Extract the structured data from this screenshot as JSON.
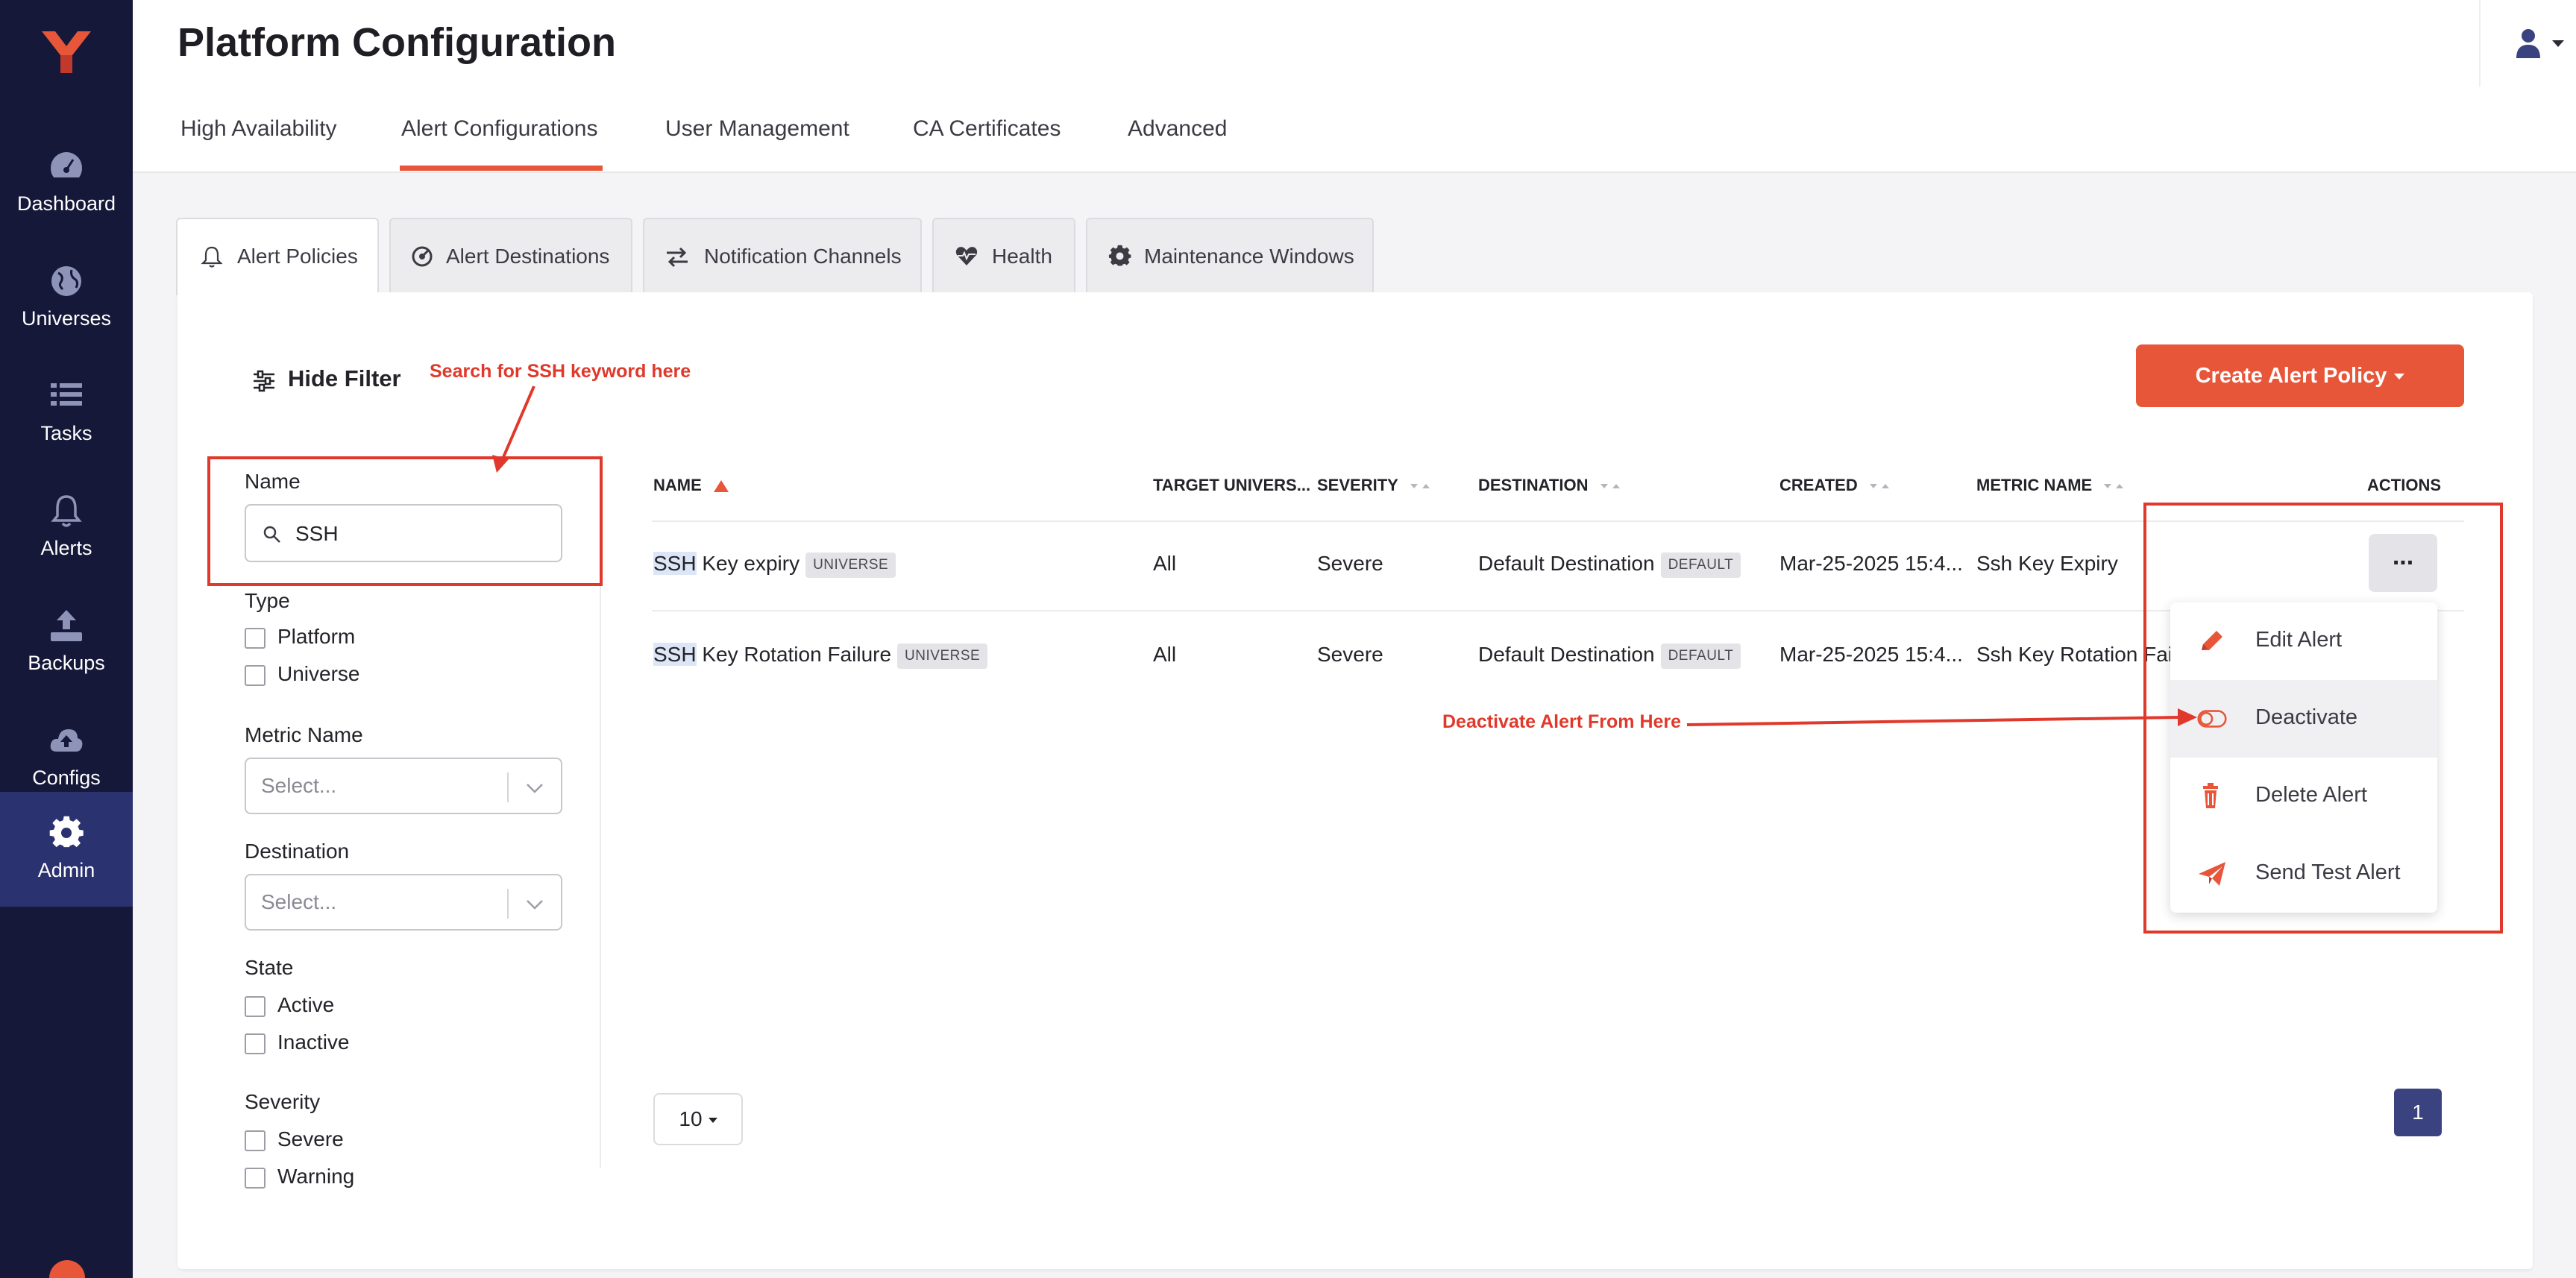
{
  "app": {
    "page_title": "Platform Configuration"
  },
  "sidebar": {
    "items": [
      {
        "label": "Dashboard",
        "icon": "dashboard-icon"
      },
      {
        "label": "Universes",
        "icon": "globe-icon"
      },
      {
        "label": "Tasks",
        "icon": "tasks-list-icon"
      },
      {
        "label": "Alerts",
        "icon": "bell-icon"
      },
      {
        "label": "Backups",
        "icon": "upload-icon"
      },
      {
        "label": "Configs",
        "icon": "cloud-upload-icon"
      },
      {
        "label": "Admin",
        "icon": "gear-icon",
        "active": true
      }
    ]
  },
  "top_tabs": [
    {
      "label": "High Availability"
    },
    {
      "label": "Alert Configurations",
      "active": true
    },
    {
      "label": "User Management"
    },
    {
      "label": "CA Certificates"
    },
    {
      "label": "Advanced"
    }
  ],
  "sub_tabs": [
    {
      "label": "Alert Policies",
      "icon": "bell-outline-icon",
      "active": true
    },
    {
      "label": "Alert Destinations",
      "icon": "target-icon"
    },
    {
      "label": "Notification Channels",
      "icon": "exchange-icon"
    },
    {
      "label": "Health",
      "icon": "heartbeat-icon"
    },
    {
      "label": "Maintenance Windows",
      "icon": "gear-icon"
    }
  ],
  "toolbar": {
    "hide_filter_label": "Hide Filter",
    "create_label": "Create Alert Policy"
  },
  "filters": {
    "name_label": "Name",
    "name_value": "SSH",
    "type_label": "Type",
    "type_options": [
      "Platform",
      "Universe"
    ],
    "metric_label": "Metric Name",
    "metric_placeholder": "Select...",
    "destination_label": "Destination",
    "destination_placeholder": "Select...",
    "state_label": "State",
    "state_options": [
      "Active",
      "Inactive"
    ],
    "severity_label": "Severity",
    "severity_options": [
      "Severe",
      "Warning"
    ]
  },
  "table": {
    "columns": [
      "NAME",
      "TARGET UNIVERS...",
      "SEVERITY",
      "DESTINATION",
      "CREATED",
      "METRIC NAME",
      "ACTIONS"
    ],
    "rows": [
      {
        "name_highlight": "SSH",
        "name_rest": " Key expiry",
        "name_tag": "UNIVERSE",
        "target": "All",
        "severity": "Severe",
        "destination": "Default Destination",
        "destination_tag": "DEFAULT",
        "created": "Mar-25-2025 15:4...",
        "metric": "Ssh Key Expiry"
      },
      {
        "name_highlight": "SSH",
        "name_rest": " Key Rotation Failure",
        "name_tag": "UNIVERSE",
        "target": "All",
        "severity": "Severe",
        "destination": "Default Destination",
        "destination_tag": "DEFAULT",
        "created": "Mar-25-2025 15:4...",
        "metric": "Ssh Key Rotation Fail"
      }
    ],
    "actions_label": "..."
  },
  "actions_menu": [
    {
      "label": "Edit Alert",
      "icon": "pencil-icon"
    },
    {
      "label": "Deactivate",
      "icon": "toggle-off-icon"
    },
    {
      "label": "Delete Alert",
      "icon": "trash-icon"
    },
    {
      "label": "Send Test Alert",
      "icon": "paper-plane-icon"
    }
  ],
  "pagination": {
    "page_size": "10",
    "current_page": "1"
  },
  "annotations": {
    "search_hint": "Search for SSH keyword here",
    "deactivate_hint": "Deactivate Alert From Here"
  },
  "colors": {
    "sidebar_bg": "#151838",
    "sidebar_active": "#2b3270",
    "accent": "#e8563a",
    "annotation_red": "#e0392b",
    "page_button": "#3a4280"
  }
}
